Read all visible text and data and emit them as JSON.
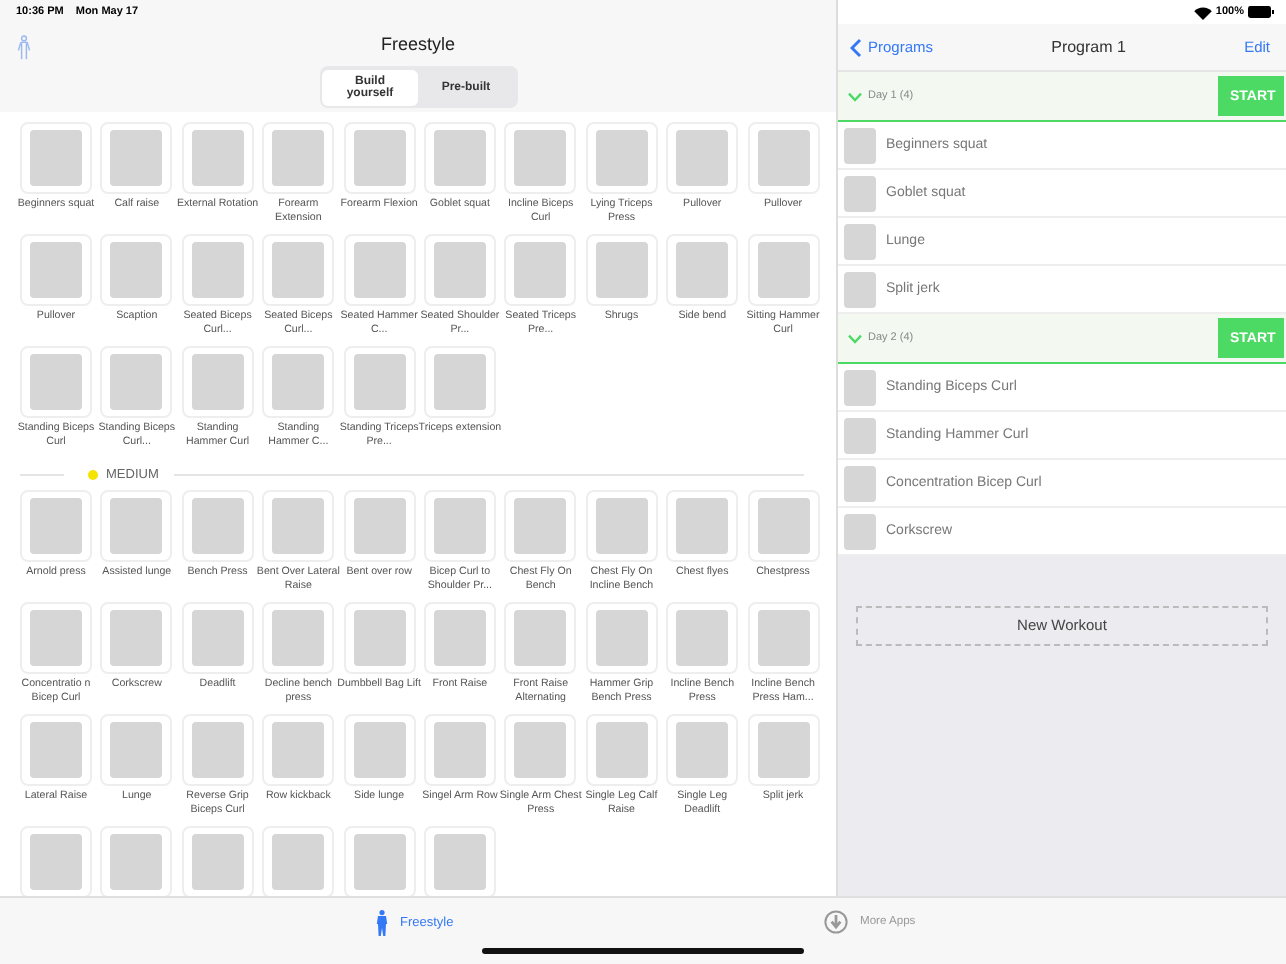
{
  "status_bar": {
    "time": "10:36 PM",
    "date": "Mon May 17",
    "battery": "100%"
  },
  "left": {
    "title": "Freestyle",
    "segments": [
      {
        "label": "Build yourself",
        "selected": true
      },
      {
        "label": "Pre-built",
        "selected": false
      }
    ],
    "easy_exercises": [
      "Beginners squat",
      "Calf raise",
      "External Rotation",
      "Forearm Extension",
      "Forearm Flexion",
      "Goblet squat",
      "Incline Biceps Curl",
      "Lying Triceps Press",
      "Pullover",
      "Pullover",
      "Pullover",
      "Scaption",
      "Seated Biceps Curl...",
      "Seated Biceps Curl...",
      "Seated Hammer C...",
      "Seated Shoulder Pr...",
      "Seated Triceps Pre...",
      "Shrugs",
      "Side bend",
      "Sitting Hammer Curl",
      "Standing Biceps Curl",
      "Standing Biceps Curl...",
      "Standing Hammer Curl",
      "Standing Hammer C...",
      "Standing Triceps Pre...",
      "Triceps extension"
    ],
    "medium": {
      "heading": "MEDIUM",
      "color": "#f5e400",
      "exercises": [
        "Arnold press",
        "Assisted lunge",
        "Bench Press",
        "Bent Over Lateral Raise",
        "Bent over row",
        "Bicep Curl to Shoulder Pr...",
        "Chest Fly On Bench",
        "Chest Fly On Incline Bench",
        "Chest flyes",
        "Chestpress",
        "Concentratio n Bicep Curl",
        "Corkscrew",
        "Deadlift",
        "Decline bench press",
        "Dumbbell Bag Lift",
        "Front Raise",
        "Front Raise Alternating",
        "Hammer Grip Bench Press",
        "Incline Bench Press",
        "Incline Bench Press Ham...",
        "Lateral Raise",
        "Lunge",
        "Reverse Grip Biceps Curl",
        "Row kickback",
        "Side lunge",
        "Singel Arm Row",
        "Single Arm Chest Press",
        "Single Leg Calf Raise",
        "Single Leg Deadlift",
        "Split jerk"
      ],
      "covered_tiles": [
        {
          "kind": "photo"
        },
        {
          "kind": "photo"
        },
        {
          "kind": "photo"
        },
        {
          "kind": "photo"
        },
        {
          "kind": "photo"
        },
        {
          "kind": "photo"
        }
      ]
    }
  },
  "right": {
    "back": "Programs",
    "title": "Program 1",
    "edit": "Edit",
    "days": [
      {
        "label": "Day 1 (4)",
        "expanded": true,
        "button": "START",
        "exercises": [
          "Beginners squat",
          "Goblet squat",
          "Lunge",
          "Split jerk"
        ]
      },
      {
        "label": "Day 2 (4)",
        "expanded": true,
        "button": "START",
        "exercises": [
          "Standing Biceps Curl",
          "Standing Hammer Curl",
          "Concentration Bicep Curl",
          "Corkscrew"
        ]
      }
    ],
    "new_workout": "New Workout"
  },
  "tab_bar": [
    {
      "label": "Freestyle",
      "selected": true,
      "kind": "figure"
    },
    {
      "label": "More Apps",
      "selected": false,
      "kind": "download"
    }
  ]
}
